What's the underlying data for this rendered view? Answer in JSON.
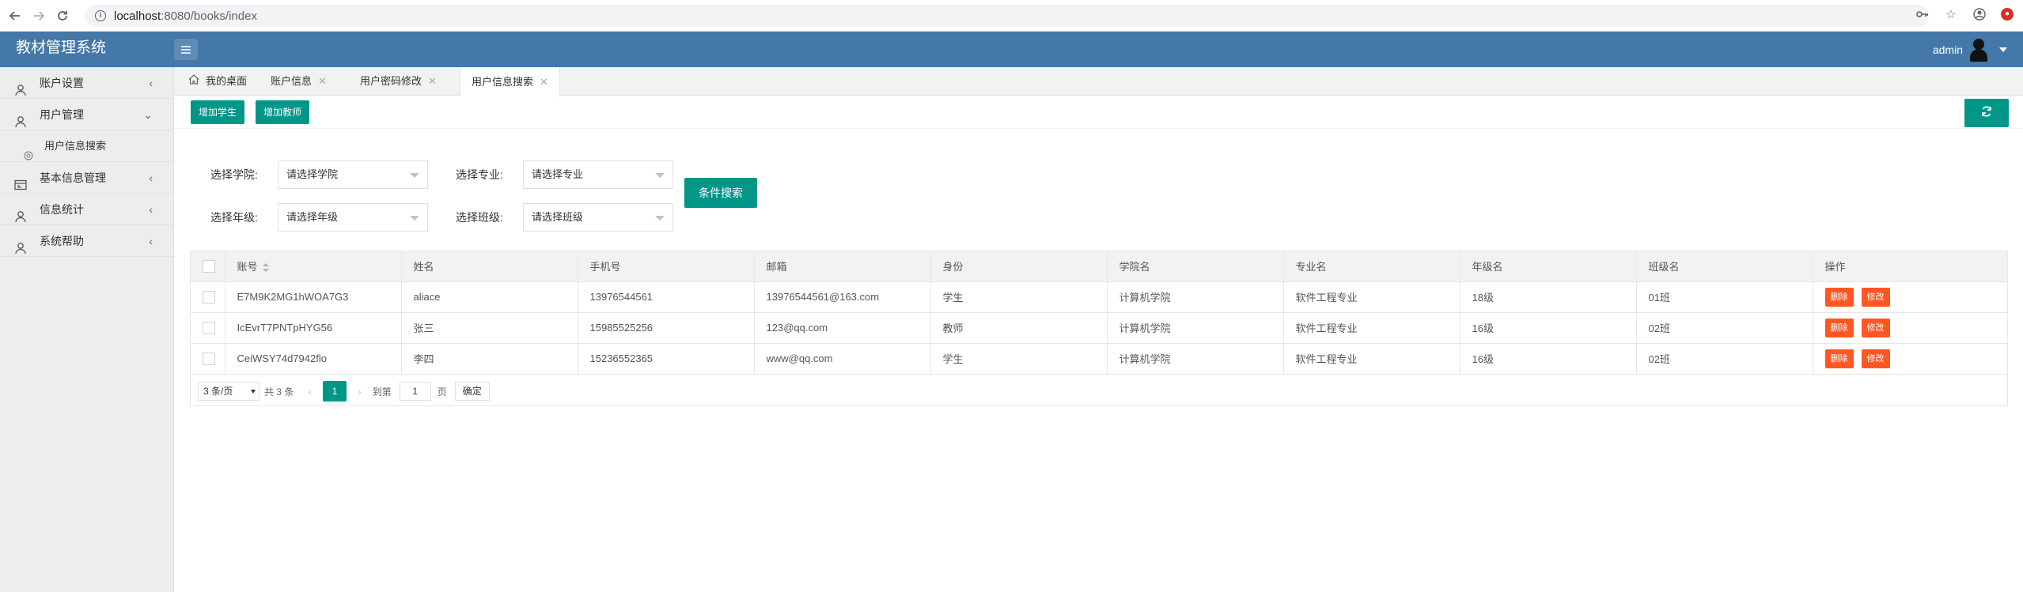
{
  "browser": {
    "url_host": "localhost",
    "url_path": ":8080/books/index"
  },
  "header": {
    "app_title": "教材管理系统",
    "username": "admin"
  },
  "sidebar": {
    "items": [
      {
        "label": "账户设置",
        "arrow": "‹"
      },
      {
        "label": "用户管理",
        "arrow": "⌄"
      },
      {
        "label": "用户信息搜索"
      },
      {
        "label": "基本信息管理",
        "arrow": "‹"
      },
      {
        "label": "信息统计",
        "arrow": "‹"
      },
      {
        "label": "系统帮助",
        "arrow": "‹"
      }
    ]
  },
  "tabs": [
    {
      "label": "我的桌面"
    },
    {
      "label": "账户信息"
    },
    {
      "label": "用户密码修改"
    },
    {
      "label": "用户信息搜索"
    }
  ],
  "toolbar": {
    "add_student": "增加学生",
    "add_teacher": "增加教师"
  },
  "filters": {
    "college_label": "选择学院:",
    "college_value": "请选择学院",
    "major_label": "选择专业:",
    "major_value": "请选择专业",
    "grade_label": "选择年级:",
    "grade_value": "请选择年级",
    "class_label": "选择班级:",
    "class_value": "请选择班级",
    "search_button": "条件搜索"
  },
  "table": {
    "headers": [
      "账号",
      "姓名",
      "手机号",
      "邮箱",
      "身份",
      "学院名",
      "专业名",
      "年级名",
      "班级名",
      "操作"
    ],
    "rows": [
      [
        "E7M9K2MG1hWOA7G3",
        "aliace",
        "13976544561",
        "13976544561@163.com",
        "学生",
        "计算机学院",
        "软件工程专业",
        "18级",
        "01班"
      ],
      [
        "IcEvrT7PNTpHYG56",
        "张三",
        "15985525256",
        "123@qq.com",
        "教师",
        "计算机学院",
        "软件工程专业",
        "16级",
        "02班"
      ],
      [
        "CeiWSY74d7942flo",
        "李四",
        "15236552365",
        "www@qq.com",
        "学生",
        "计算机学院",
        "软件工程专业",
        "16级",
        "02班"
      ]
    ],
    "delete_label": "删除",
    "edit_label": "修改"
  },
  "pager": {
    "page_size": "3 条/页",
    "total": "共 3 条",
    "current_page": "1",
    "goto_label": "到第",
    "goto_value": "1",
    "page_suffix": "页",
    "confirm": "确定"
  }
}
